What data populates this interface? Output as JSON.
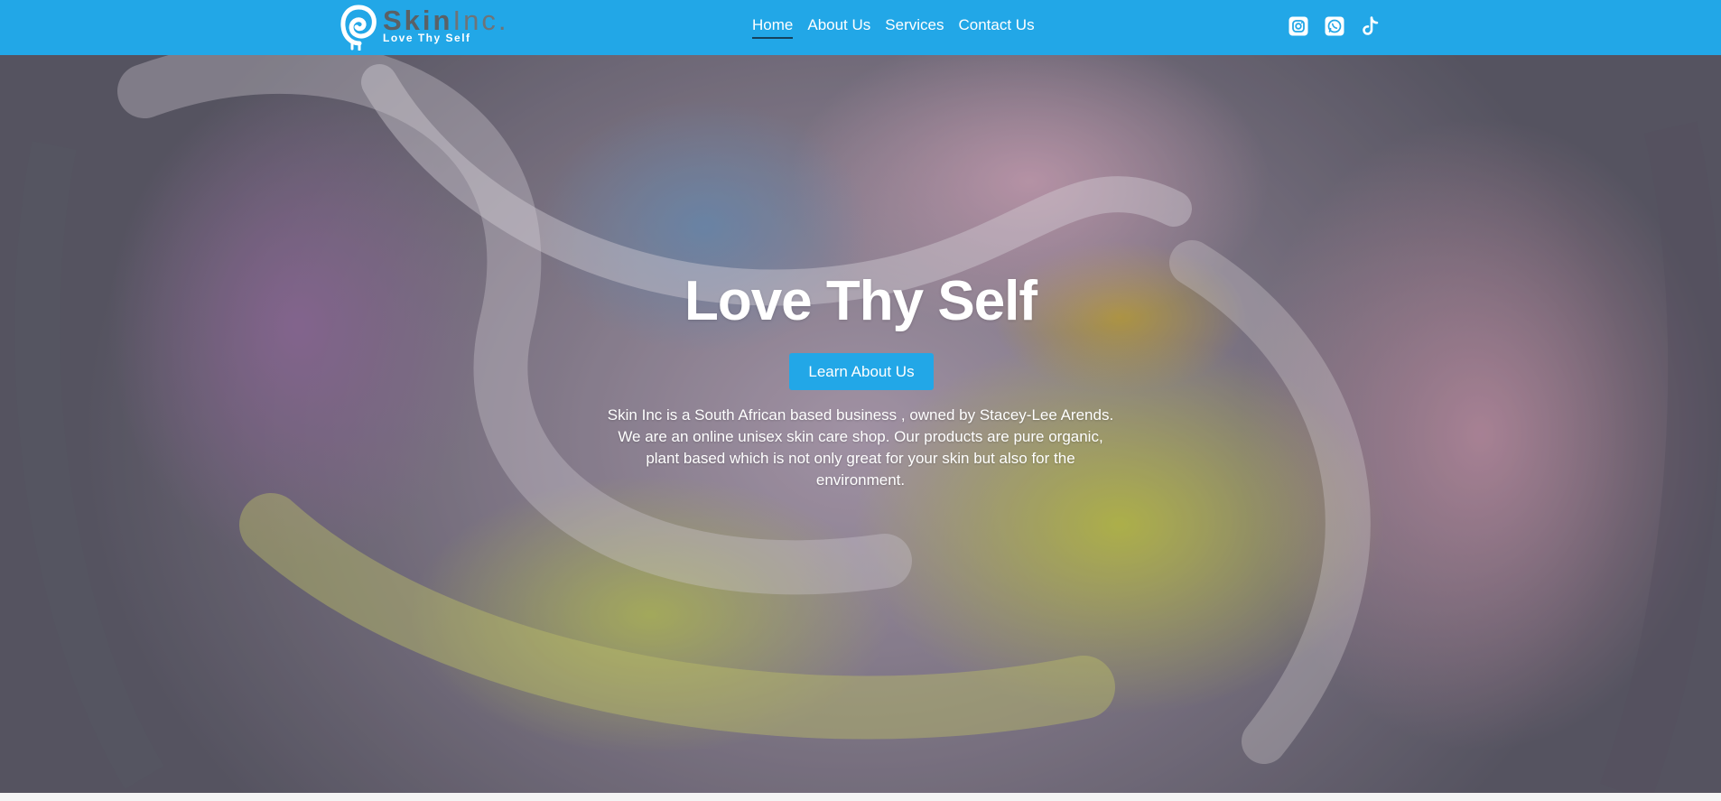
{
  "brand": {
    "name_bold": "Skin",
    "name_light": "Inc.",
    "tagline": "Love Thy Self",
    "color": "#22a7e7"
  },
  "nav": {
    "items": [
      {
        "label": "Home",
        "active": true
      },
      {
        "label": "About Us",
        "active": false
      },
      {
        "label": "Services",
        "active": false
      },
      {
        "label": "Contact Us",
        "active": false
      }
    ]
  },
  "social": [
    {
      "icon": "instagram-icon"
    },
    {
      "icon": "whatsapp-icon"
    },
    {
      "icon": "tiktok-icon"
    }
  ],
  "hero": {
    "title": "Love Thy Self",
    "cta_label": "Learn About Us",
    "description": "Skin Inc is a South African based business , owned by Stacey-Lee Arends. We are an online unisex skin care shop. Our products are pure organic, plant based which is not only great for your skin but also for the environment."
  }
}
